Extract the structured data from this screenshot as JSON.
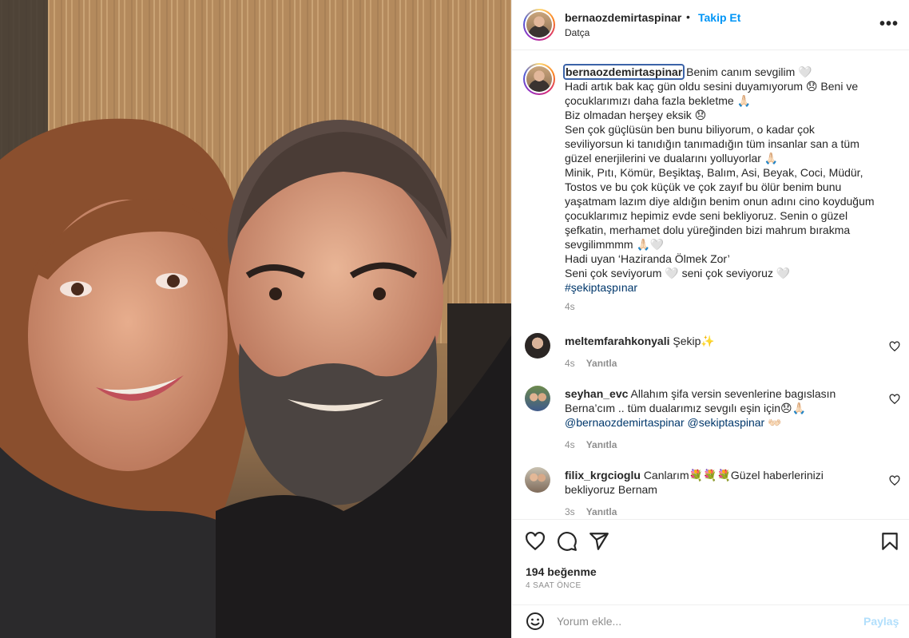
{
  "post": {
    "username": "bernaozdemirtaspinar",
    "follow_label": "Takip Et",
    "separator": "•",
    "location": "Datça",
    "more_label": "•••"
  },
  "caption": {
    "username": "bernaozdemirtaspinar",
    "lines": [
      "Benim canım sevgilim 🤍",
      "Hadi artık bak kaç gün oldu sesini duyamıyorum 😞 Beni ve",
      "çocuklarımızı daha fazla bekletme 🙏🏻",
      "Biz olmadan herşey eksik 😞",
      "Sen çok güçlüsün ben bunu biliyorum, o kadar çok",
      "seviliyorsun ki tanıdığın tanımadığın tüm insanlar san a tüm",
      "güzel enerjilerini ve dualarını yolluyorlar 🙏🏻",
      "Minik, Pıtı, Kömür, Beşiktaş, Balım, Asi, Beyak, Coci, Müdür,",
      "Tostos ve bu çok küçük ve çok zayıf bu ölür benim bunu",
      "yaşatmam lazım diye aldığın benim onun adını cino koyduğum",
      "çocuklarımız hepimiz evde seni bekliyoruz. Senin o güzel",
      "şefkatin, merhamet dolu yüreğinden bizi mahrum bırakma",
      "sevgilimmmm 🙏🏻🤍",
      "Hadi uyan ‘Haziranda Ölmek Zor’",
      "Seni çok seviyorum 🤍 seni çok seviyoruz 🤍"
    ],
    "hashtag": "#şekiptaşpınar",
    "time": "4s"
  },
  "comments": [
    {
      "username": "meltemfarahkonyali",
      "lines": [
        "Şekip✨"
      ],
      "mentions": "",
      "time": "4s",
      "reply_label": "Yanıtla"
    },
    {
      "username": "seyhan_evc",
      "lines": [
        "Allahım şifa versin sevenlerine bagıslasın",
        "Berna’cım .. tüm dualarımız sevgılı eşin için😞🙏🏻"
      ],
      "mentions": "@bernaozdemirtaspinar @sekiptaspinar 👐🏻",
      "time": "4s",
      "reply_label": "Yanıtla"
    },
    {
      "username": "filix_krgcioglu",
      "lines": [
        "Canlarım💐💐💐Güzel haberlerinizi",
        "bekliyoruz Bernam"
      ],
      "mentions": "",
      "time": "3s",
      "reply_label": "Yanıtla"
    }
  ],
  "actions": {
    "icons": [
      "heart-icon",
      "comment-icon",
      "share-icon",
      "bookmark-icon"
    ],
    "likes": "194 beğenme",
    "time_ago": "4 SAAT ÖNCE"
  },
  "comment_box": {
    "placeholder": "Yorum ekle...",
    "post_label": "Paylaş"
  },
  "colors": {
    "accent": "#0095f6",
    "link": "#00376b",
    "muted": "#8e8e8e",
    "text": "#262626",
    "post_disabled": "#b2dffc"
  }
}
